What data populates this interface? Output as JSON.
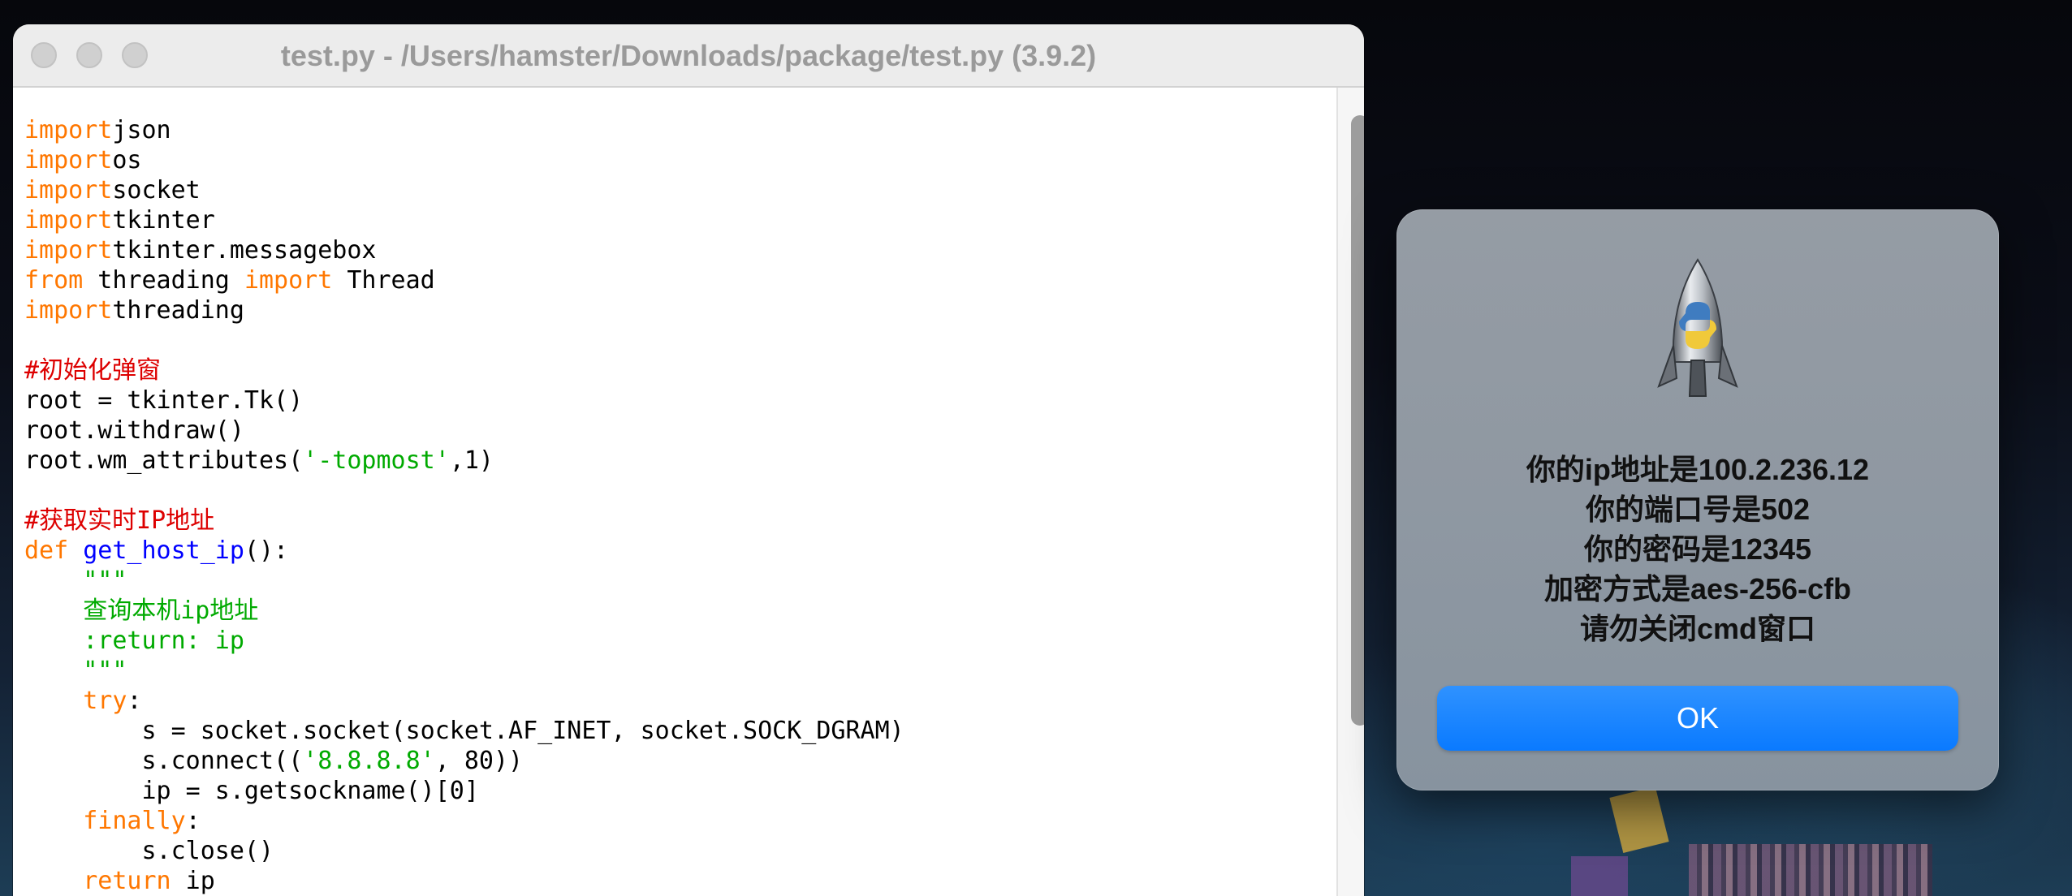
{
  "editor": {
    "title": "test.py - /Users/hamster/Downloads/package/test.py (3.9.2)",
    "code": [
      [
        [
          "kw",
          "import"
        ],
        [
          "",
          "json"
        ]
      ],
      [
        [
          "kw",
          "import"
        ],
        [
          "",
          "os"
        ]
      ],
      [
        [
          "kw",
          "import"
        ],
        [
          "",
          "socket"
        ]
      ],
      [
        [
          "kw",
          "import"
        ],
        [
          "",
          "tkinter"
        ]
      ],
      [
        [
          "kw",
          "import"
        ],
        [
          "",
          "tkinter.messagebox"
        ]
      ],
      [
        [
          "kw",
          "from"
        ],
        [
          "",
          " threading "
        ],
        [
          "kw",
          "import"
        ],
        [
          "",
          " Thread"
        ]
      ],
      [
        [
          "kw",
          "import"
        ],
        [
          "",
          "threading"
        ]
      ],
      [],
      [
        [
          "cm",
          "#初始化弹窗"
        ]
      ],
      [
        [
          "",
          "root = tkinter.Tk()"
        ]
      ],
      [
        [
          "",
          "root.withdraw()"
        ]
      ],
      [
        [
          "",
          "root.wm_attributes("
        ],
        [
          "st",
          "'-topmost'"
        ],
        [
          "",
          ",1)"
        ]
      ],
      [],
      [
        [
          "cm",
          "#获取实时IP地址"
        ]
      ],
      [
        [
          "kw",
          "def"
        ],
        [
          "",
          " "
        ],
        [
          "df",
          "get_host_ip"
        ],
        [
          "",
          "():"
        ]
      ],
      [
        [
          "",
          "    "
        ],
        [
          "st",
          "\"\"\""
        ]
      ],
      [
        [
          "",
          "    "
        ],
        [
          "st",
          "查询本机ip地址"
        ]
      ],
      [
        [
          "",
          "    "
        ],
        [
          "st",
          ":return: ip"
        ]
      ],
      [
        [
          "",
          "    "
        ],
        [
          "st",
          "\"\"\""
        ]
      ],
      [
        [
          "",
          "    "
        ],
        [
          "kw",
          "try"
        ],
        [
          "",
          ":"
        ]
      ],
      [
        [
          "",
          "        s = socket.socket(socket.AF_INET, socket.SOCK_DGRAM)"
        ]
      ],
      [
        [
          "",
          "        s.connect(("
        ],
        [
          "st",
          "'8.8.8.8'"
        ],
        [
          "",
          ", 80))"
        ]
      ],
      [
        [
          "",
          "        ip = s.getsockname()[0]"
        ]
      ],
      [
        [
          "",
          "    "
        ],
        [
          "kw",
          "finally"
        ],
        [
          "",
          ":"
        ]
      ],
      [
        [
          "",
          "        s.close()"
        ]
      ],
      [
        [
          "",
          "    "
        ],
        [
          "kw",
          "return"
        ],
        [
          "",
          " ip"
        ]
      ]
    ]
  },
  "dialog": {
    "icon": "python-launcher-rocket-icon",
    "message_lines": [
      "你的ip地址是100.2.236.12",
      "你的端口号是502",
      "你的密码是12345",
      "加密方式是aes-256-cfb",
      "请勿关闭cmd窗口"
    ],
    "ok_label": "OK"
  },
  "colors": {
    "keyword": "#ff7700",
    "comment": "#dd0000",
    "string": "#00aa00",
    "definition": "#0000ff",
    "button_blue": "#0a7aff"
  }
}
